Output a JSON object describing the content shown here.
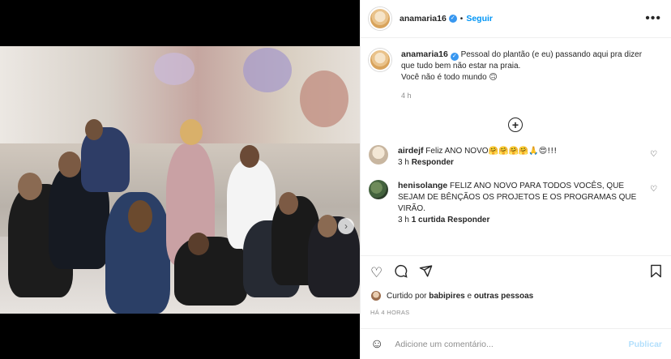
{
  "post": {
    "username": "anamaria16",
    "follow_label": "Seguir",
    "more_icon": "more-horizontal-icon",
    "verified_icon": "verified-badge-icon"
  },
  "caption": {
    "username": "anamaria16",
    "text_line1": "Pessoal do plantão (e eu) passando aqui pra dizer",
    "text_line2": "que tudo bem não estar na praia.",
    "text_line3": "Você não é todo mundo",
    "emoji": "🙃",
    "time": "4 h"
  },
  "comments": [
    {
      "username": "airdejf",
      "text": "Feliz ANO NOVO",
      "emojis": "🤗🤗🤗🤗🙏😍!!!",
      "time": "3 h",
      "reply_label": "Responder",
      "likes_label": ""
    },
    {
      "username": "henisolange",
      "text": "FELIZ ANO NOVO PARA TODOS VOCÊS, QUE SEJAM DE BÊNÇÃOS OS PROJETOS E OS PROGRAMAS QUE VIRÃO.",
      "time": "3 h",
      "likes_label": "1 curtida",
      "reply_label": "Responder"
    }
  ],
  "engagement": {
    "liked_prefix": "Curtido por",
    "liked_user": "babipires",
    "liked_middle": "e",
    "liked_others": "outras pessoas",
    "time_ago": "HÁ 4 HORAS"
  },
  "add_comment": {
    "placeholder": "Adicione um comentário...",
    "publish_label": "Publicar"
  },
  "carousel": {
    "slide_count": 3,
    "active_index": 0
  },
  "colors": {
    "link_blue": "#0095f6",
    "publish_disabled": "#b2dffc",
    "muted": "#8e8e8e"
  }
}
